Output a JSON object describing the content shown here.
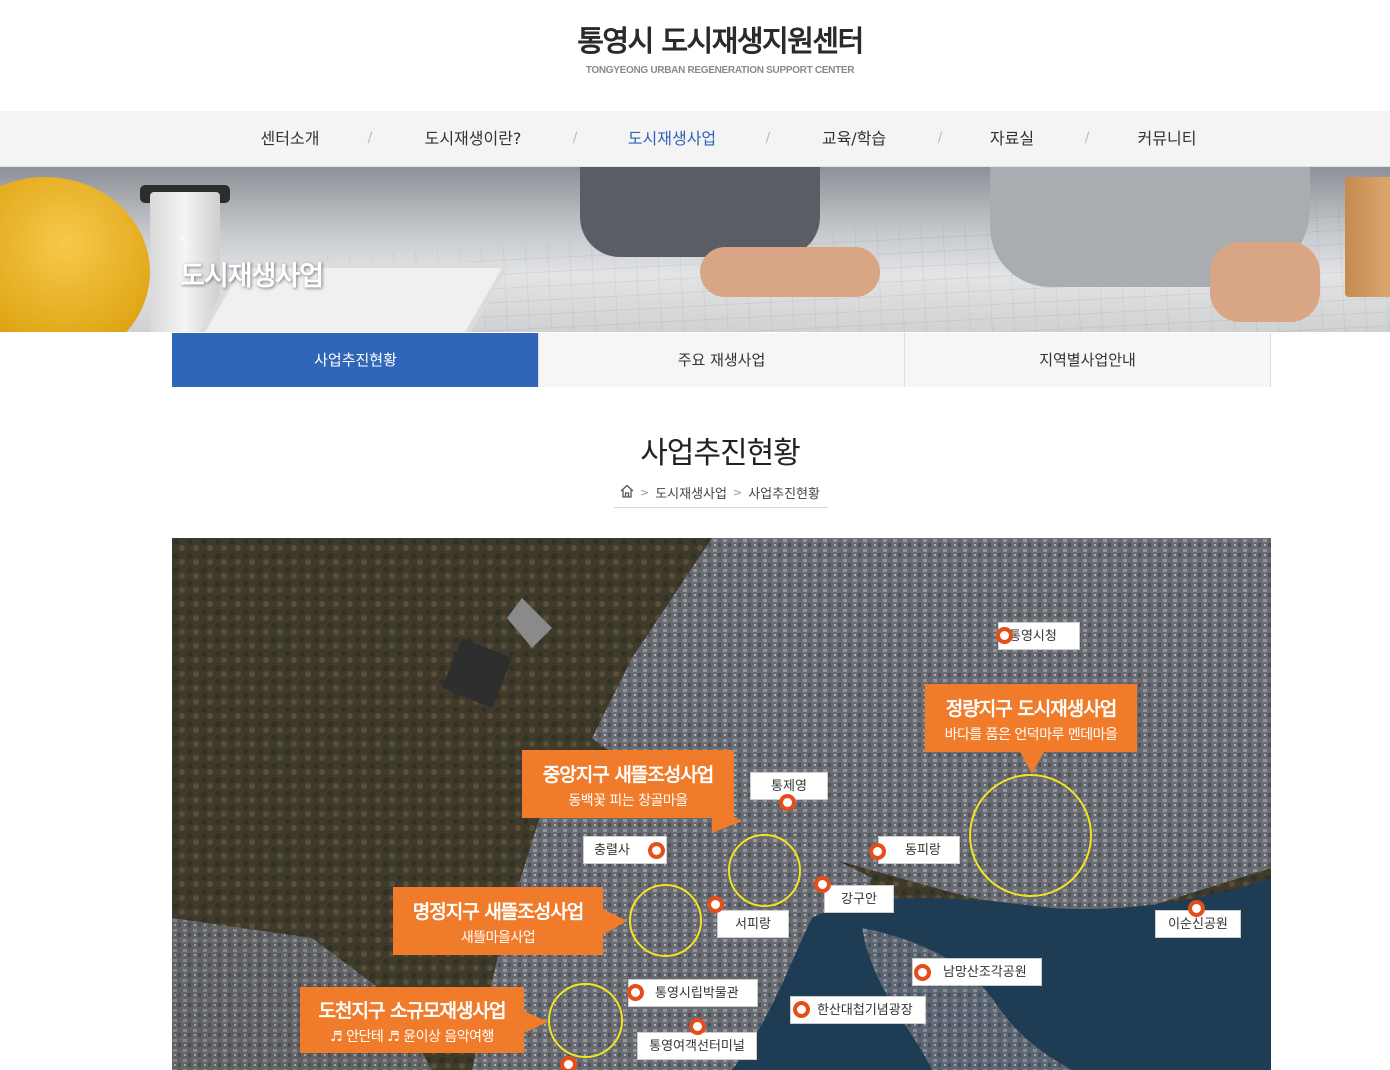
{
  "header": {
    "title_kr": "통영시 도시재생지원센터",
    "title_en": "TONGYEONG URBAN REGENERATION SUPPORT CENTER"
  },
  "gnb": {
    "items": [
      {
        "label": "센터소개"
      },
      {
        "label": "도시재생이란?"
      },
      {
        "label": "도시재생사업",
        "active": true
      },
      {
        "label": "교육/학습"
      },
      {
        "label": "자료실"
      },
      {
        "label": "커뮤니티"
      }
    ],
    "separator": "/"
  },
  "banner": {
    "mark": "ˋ",
    "title": "도시재생사업"
  },
  "subtabs": [
    {
      "label": "사업추진현황",
      "active": true
    },
    {
      "label": "주요 재생사업"
    },
    {
      "label": "지역별사업안내"
    }
  ],
  "page": {
    "title": "사업추진현황"
  },
  "breadcrumb": {
    "home_icon": "home-icon",
    "sep": ">",
    "items": [
      "도시재생사업",
      "사업추진현황"
    ]
  },
  "map": {
    "callouts": [
      {
        "title": "정량지구 도시재생사업",
        "subtitle": "바다를 품은 언덕마루 멘데마을"
      },
      {
        "title": "중앙지구 새뜰조성사업",
        "subtitle": "동백꽃 피는 창골마을"
      },
      {
        "title": "명정지구 새뜰조성사업",
        "subtitle": "새뜰마을사업"
      },
      {
        "title": "도천지구 소규모재생사업",
        "subtitle": "♬ 안단테 ♬ 윤이상 음악여행"
      }
    ],
    "places": [
      {
        "name": "통영시청"
      },
      {
        "name": "통제영"
      },
      {
        "name": "충렬사"
      },
      {
        "name": "동피랑"
      },
      {
        "name": "강구안"
      },
      {
        "name": "서피랑"
      },
      {
        "name": "이순신공원"
      },
      {
        "name": "남망산조각공원"
      },
      {
        "name": "통영시립박물관"
      },
      {
        "name": "한산대첩기념광장"
      },
      {
        "name": "통영여객선터미널"
      }
    ],
    "colors": {
      "callout": "#f07b2b",
      "pin": "#e54e1b",
      "ring": "#f2e51b",
      "sea": "#1f3c55"
    }
  },
  "colors": {
    "accent": "#2f66b8"
  }
}
